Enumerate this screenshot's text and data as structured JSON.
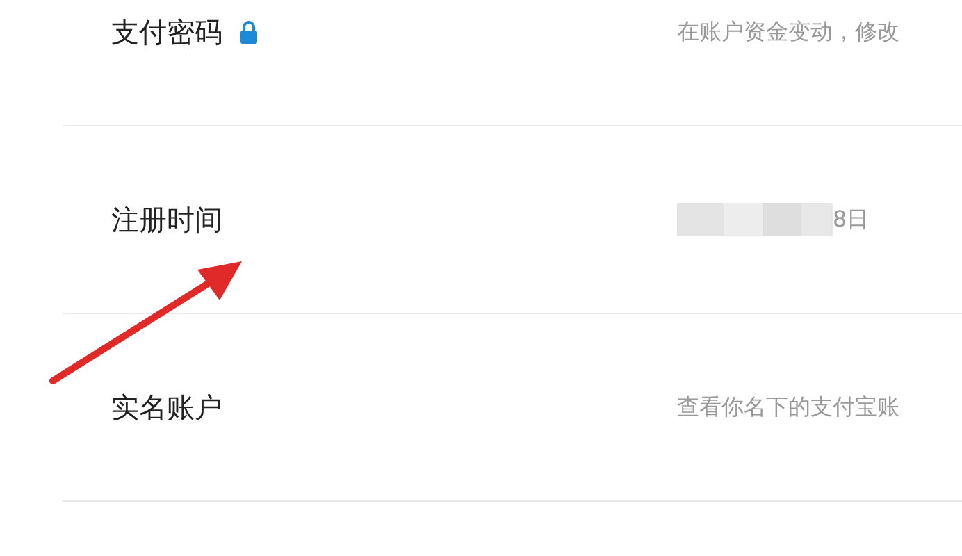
{
  "rows": [
    {
      "label": "支付密码",
      "locked": true,
      "value": "在账户资金变动，修改",
      "blurred": false
    },
    {
      "label": "注册时间",
      "locked": false,
      "value": "8日",
      "blurred": true
    },
    {
      "label": "实名账户",
      "locked": false,
      "value": "查看你名下的支付宝账",
      "blurred": false
    }
  ]
}
